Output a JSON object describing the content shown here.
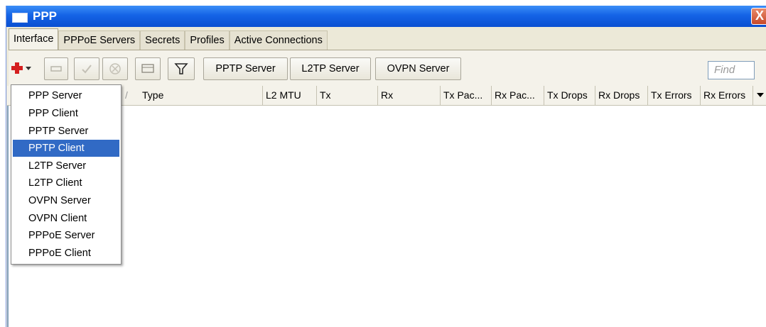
{
  "window": {
    "title": "PPP",
    "close_glyph": "X"
  },
  "tabs": [
    {
      "label": "Interface",
      "active": true
    },
    {
      "label": "PPPoE Servers",
      "active": false
    },
    {
      "label": "Secrets",
      "active": false
    },
    {
      "label": "Profiles",
      "active": false
    },
    {
      "label": "Active Connections",
      "active": false
    }
  ],
  "toolbar": {
    "add_icon": "plus-icon",
    "remove_icon": "minus-icon",
    "enable_icon": "check-icon",
    "disable_icon": "x-icon",
    "comment_icon": "comment-icon",
    "filter_icon": "funnel-icon",
    "buttons": [
      "PPTP Server",
      "L2TP Server",
      "OVPN Server"
    ],
    "find_placeholder": "Find"
  },
  "table": {
    "columns": [
      "Type",
      "L2 MTU",
      "Tx",
      "Rx",
      "Tx Pac...",
      "Rx Pac...",
      "Tx Drops",
      "Rx Drops",
      "Tx Errors",
      "Rx Errors"
    ],
    "sort_indicator": "/",
    "rows": []
  },
  "add_menu": {
    "items": [
      "PPP Server",
      "PPP Client",
      "PPTP Server",
      "PPTP Client",
      "L2TP Server",
      "L2TP Client",
      "OVPN Server",
      "OVPN Client",
      "PPPoE Server",
      "PPPoE Client"
    ],
    "selected": "PPTP Client"
  },
  "colors": {
    "title_bar": "#1463e6",
    "menu_highlight": "#316ac5",
    "add_red": "#d41f1f",
    "window_bg": "#ece9d8"
  }
}
